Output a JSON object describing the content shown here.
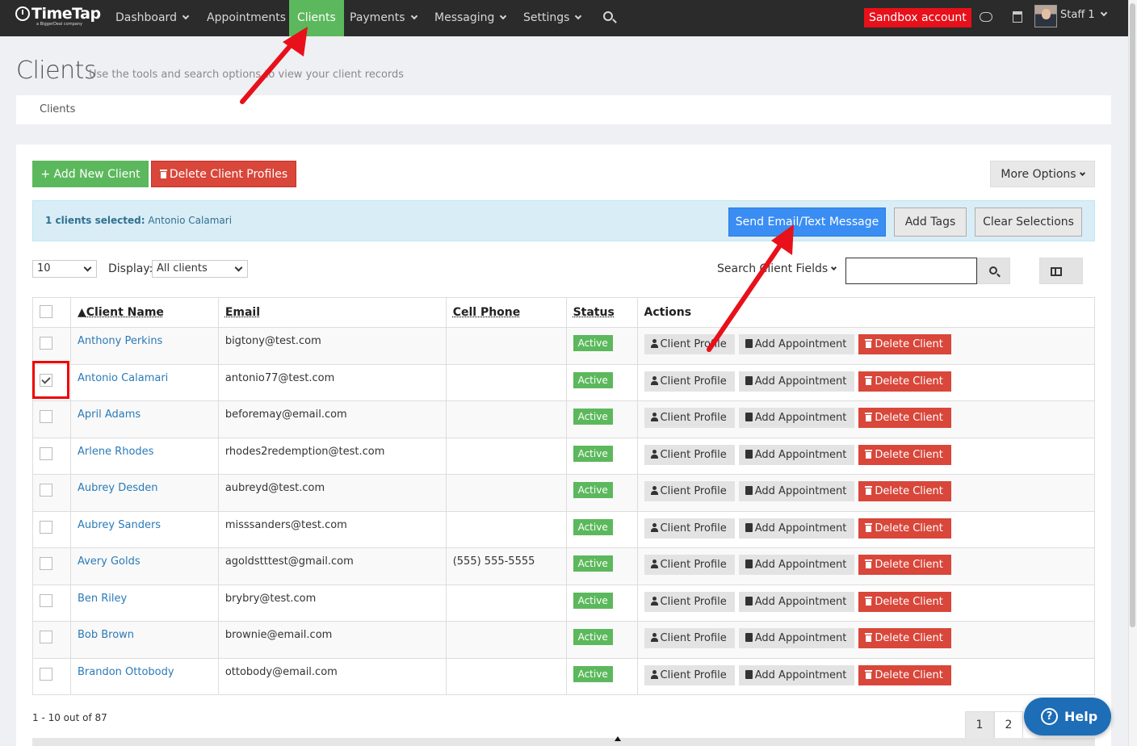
{
  "nav": {
    "logo": "TimeTap",
    "logo_sub": "a BiggerDeal company",
    "items": [
      {
        "label": "Dashboard",
        "dropdown": true
      },
      {
        "label": "Appointments",
        "dropdown": false
      },
      {
        "label": "Clients",
        "dropdown": false,
        "active": true
      },
      {
        "label": "Payments",
        "dropdown": true
      },
      {
        "label": "Messaging",
        "dropdown": true
      },
      {
        "label": "Settings",
        "dropdown": true
      }
    ],
    "sandbox_label": "Sandbox account",
    "user_label": "Staff 1"
  },
  "page": {
    "title": "Clients",
    "subtitle": "Use the tools and search options to view your client records",
    "breadcrumb": "Clients"
  },
  "toolbar": {
    "add_label": "+ Add New Client",
    "delete_profiles_label": "Delete Client Profiles",
    "more_options_label": "More Options"
  },
  "selection": {
    "count_text": "1 clients selected:",
    "names": "Antonio Calamari",
    "send_label": "Send Email/Text Message",
    "tags_label": "Add Tags",
    "clear_label": "Clear Selections"
  },
  "filters": {
    "page_size": "10",
    "display_label": "Display:",
    "display_value": "All clients",
    "search_label": "Search Client Fields",
    "search_value": ""
  },
  "table": {
    "headers": [
      "Client Name",
      "Email",
      "Cell Phone",
      "Status",
      "Actions"
    ],
    "action_labels": {
      "profile": "Client Profile",
      "appointment": "Add Appointment",
      "delete": "Delete Client"
    },
    "rows": [
      {
        "name": "Anthony Perkins",
        "email": "bigtony@test.com",
        "phone": "",
        "status": "Active",
        "checked": false
      },
      {
        "name": "Antonio Calamari",
        "email": "antonio77@test.com",
        "phone": "",
        "status": "Active",
        "checked": true
      },
      {
        "name": "April Adams",
        "email": "beforemay@email.com",
        "phone": "",
        "status": "Active",
        "checked": false
      },
      {
        "name": "Arlene Rhodes",
        "email": "rhodes2redemption@test.com",
        "phone": "",
        "status": "Active",
        "checked": false
      },
      {
        "name": "Aubrey Desden",
        "email": "aubreyd@test.com",
        "phone": "",
        "status": "Active",
        "checked": false
      },
      {
        "name": "Aubrey Sanders",
        "email": "misssanders@test.com",
        "phone": "",
        "status": "Active",
        "checked": false
      },
      {
        "name": "Avery Golds",
        "email": "agoldstttest@gmail.com",
        "phone": "(555) 555-5555",
        "status": "Active",
        "checked": false
      },
      {
        "name": "Ben Riley",
        "email": "brybry@test.com",
        "phone": "",
        "status": "Active",
        "checked": false
      },
      {
        "name": "Bob Brown",
        "email": "brownie@email.com",
        "phone": "",
        "status": "Active",
        "checked": false
      },
      {
        "name": "Brandon Ottobody",
        "email": "ottobody@email.com",
        "phone": "",
        "status": "Active",
        "checked": false
      }
    ]
  },
  "pagination": {
    "summary": "1 - 10 out of 87",
    "pages": [
      "1",
      "2"
    ]
  },
  "help_label": "Help",
  "colors": {
    "nav_bg": "#2b2b2b",
    "active_green": "#5cb85c",
    "danger_red": "#d9463a",
    "primary_blue": "#3a8df3",
    "annotation_red": "#e8101a"
  }
}
